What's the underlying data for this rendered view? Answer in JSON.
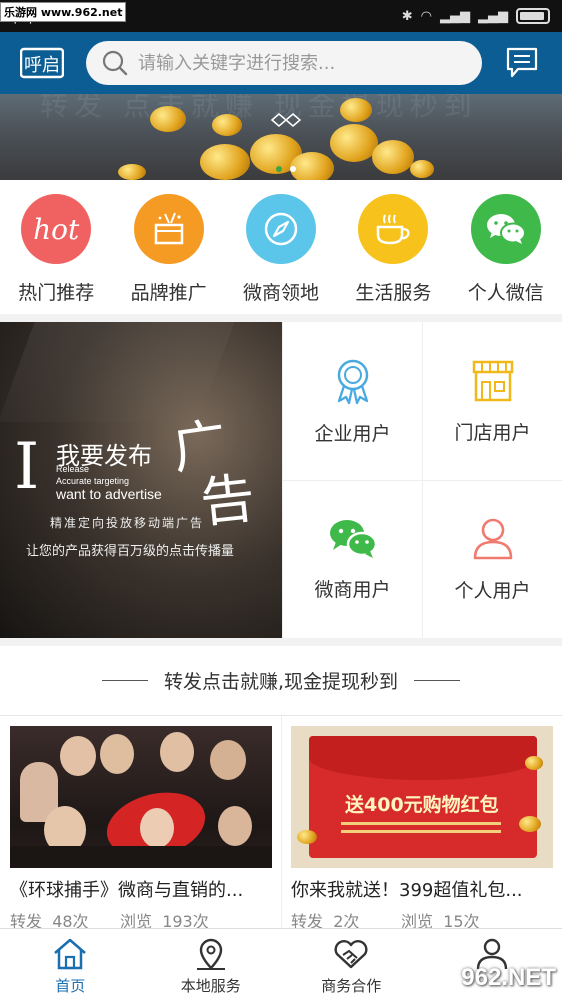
{
  "status_bar": {
    "watermark": "乐游网 www.962.net",
    "time": "下午5:30"
  },
  "header": {
    "logo_text": "呼启",
    "search_placeholder": "请输入关键字进行搜索..."
  },
  "banner": {
    "faded_text": "转发 点击就赚 现金提现秒到"
  },
  "categories": [
    {
      "label": "热门推荐",
      "icon": "hot-icon",
      "color": "#f06161",
      "icon_text": "hot"
    },
    {
      "label": "品牌推广",
      "icon": "gift-box-icon",
      "color": "#f59a23"
    },
    {
      "label": "微商领地",
      "icon": "compass-icon",
      "color": "#5cc5ea"
    },
    {
      "label": "生活服务",
      "icon": "coffee-cup-icon",
      "color": "#f7c21b"
    },
    {
      "label": "个人微信",
      "icon": "wechat-icon",
      "color": "#3fb94a"
    }
  ],
  "ad": {
    "big_i": "I",
    "line1": "我要发布",
    "char1": "广",
    "char2": "告",
    "en1": "Release",
    "en2": "Accurate targeting",
    "en3": "want to advertise",
    "cn2": "精准定向投放移动端广告",
    "cn3": "让您的产品获得百万级的点击传播量"
  },
  "user_types": [
    {
      "label": "企业用户",
      "icon": "award-ribbon-icon"
    },
    {
      "label": "门店用户",
      "icon": "storefront-icon"
    },
    {
      "label": "微商用户",
      "icon": "wechat-icon"
    },
    {
      "label": "个人用户",
      "icon": "person-icon"
    }
  ],
  "section_title": "转发点击就赚,现金提现秒到",
  "feed": [
    {
      "title": "《环球捕手》微商与直销的...",
      "share_label": "转发",
      "shares": "48次",
      "view_label": "浏览",
      "views": "193次",
      "image_icon": "celebrity-group-photo"
    },
    {
      "title": "你来我就送！399超值礼包...",
      "share_label": "转发",
      "shares": "2次",
      "view_label": "浏览",
      "views": "15次",
      "image_text": "送400元购物红包",
      "image_icon": "red-envelope-photo"
    }
  ],
  "bottom_nav": [
    {
      "label": "首页",
      "icon": "home-icon",
      "active": true
    },
    {
      "label": "本地服务",
      "icon": "map-pin-icon",
      "active": false
    },
    {
      "label": "商务合作",
      "icon": "handshake-icon",
      "active": false
    },
    {
      "label": "",
      "icon": "person-icon",
      "active": false
    }
  ],
  "watermark_br": "962.NET",
  "colors": {
    "header": "#0c5d93",
    "active_nav": "#1a6fb0"
  }
}
